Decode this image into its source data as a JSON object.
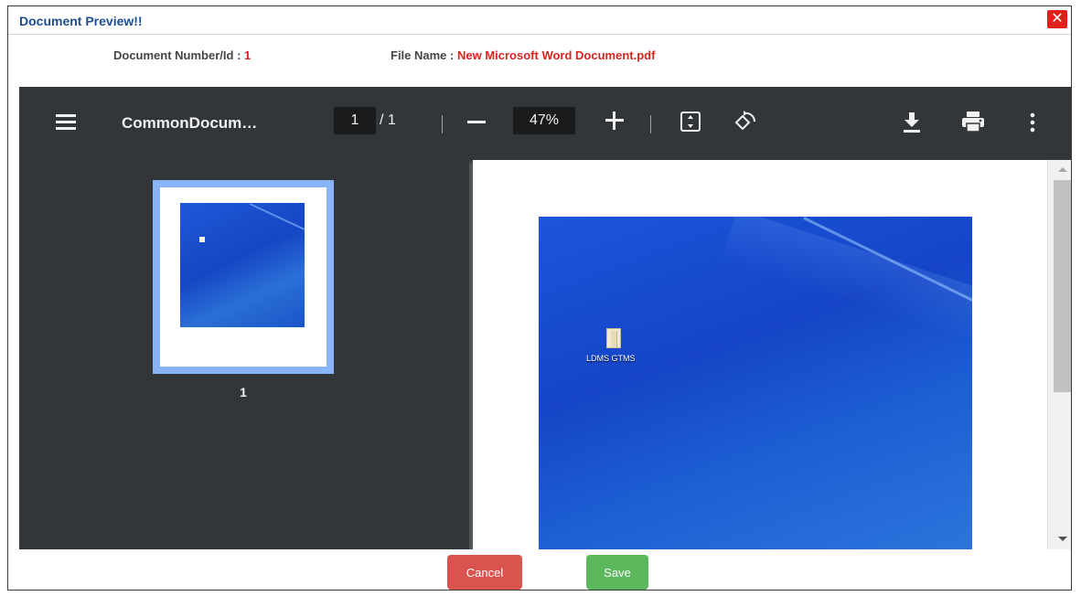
{
  "dialog": {
    "title": "Document Preview!!",
    "close_label": "✕"
  },
  "meta": {
    "doc_number_label": "Document Number/Id",
    "doc_number_sep": " : ",
    "doc_number_value": "1",
    "file_name_label": "File Name",
    "file_name_sep": " : ",
    "file_name_value": "New Microsoft Word Document.pdf"
  },
  "viewer": {
    "doc_title": "CommonDocum…",
    "current_page": "1",
    "page_sep_total": "/  1",
    "zoom": "47%",
    "thumbnail_label": "1",
    "desktop_icon_label": "LDMS GTMS"
  },
  "icons": {
    "menu": "hamburger-menu-icon",
    "fit": "fit-to-page-icon",
    "rotate": "rotate-icon",
    "download": "download-icon",
    "print": "print-icon",
    "more": "more-vertical-icon"
  },
  "actions": {
    "cancel": "Cancel",
    "save": "Save"
  },
  "colors": {
    "title": "#1f4e8c",
    "value_red": "#d9241d",
    "close_bg": "#e0201b",
    "toolbar_bg": "#323639",
    "cancel_bg": "#d9534f",
    "save_bg": "#5cb85c"
  }
}
